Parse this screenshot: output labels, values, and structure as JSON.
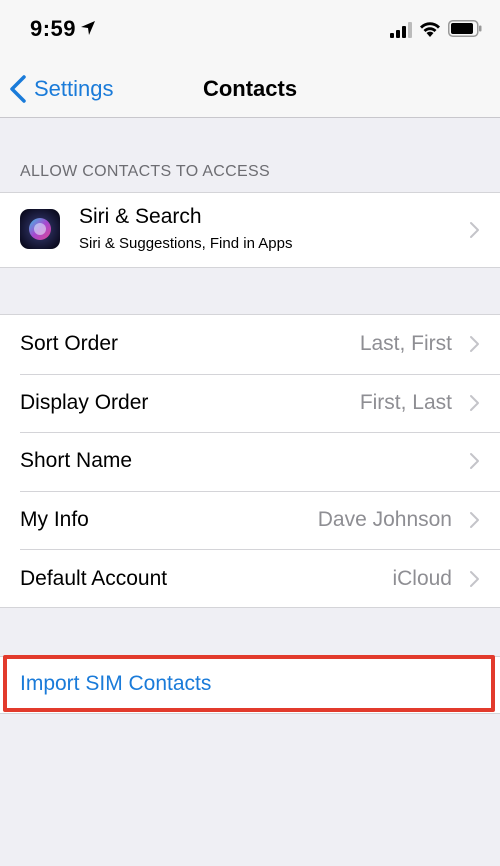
{
  "status_bar": {
    "time": "9:59"
  },
  "nav": {
    "back_label": "Settings",
    "title": "Contacts"
  },
  "section_header": "ALLOW CONTACTS TO ACCESS",
  "siri": {
    "title": "Siri & Search",
    "subtitle": "Siri & Suggestions, Find in Apps"
  },
  "settings_rows": [
    {
      "label": "Sort Order",
      "value": "Last, First"
    },
    {
      "label": "Display Order",
      "value": "First, Last"
    },
    {
      "label": "Short Name",
      "value": ""
    },
    {
      "label": "My Info",
      "value": "Dave Johnson"
    },
    {
      "label": "Default Account",
      "value": "iCloud"
    }
  ],
  "import": {
    "label": "Import SIM Contacts"
  },
  "colors": {
    "accent": "#1a7bd9",
    "highlight": "#e23a2c",
    "background": "#efeff4"
  }
}
